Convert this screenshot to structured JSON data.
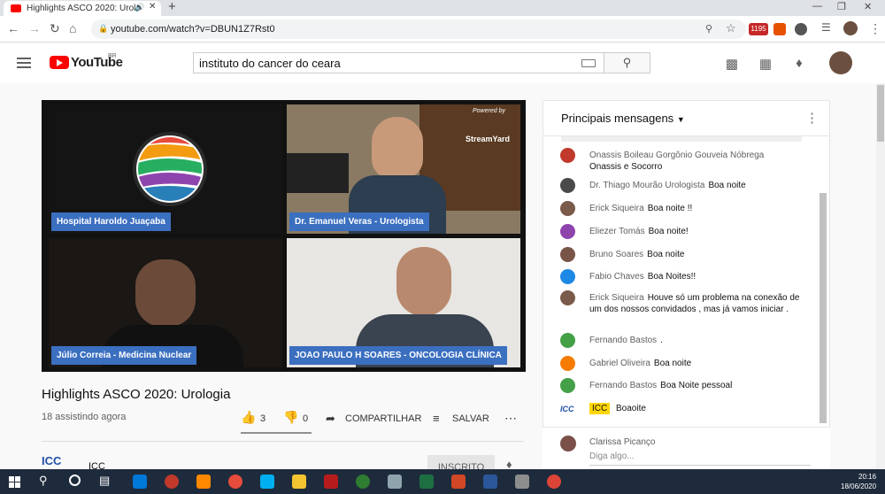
{
  "browser": {
    "tab_title": "Highlights ASCO 2020: Urolo",
    "url": "youtube.com/watch?v=DBUN1Z7Rst0",
    "ext_badge": "1195"
  },
  "youtube": {
    "logo_text": "YouTube",
    "region": "BR",
    "search_value": "instituto do cancer do ceara"
  },
  "video": {
    "watermark_top": "Powered by",
    "watermark_brand": "StreamYard",
    "participants": [
      "Hospital Haroldo Juaçaba",
      "Dr. Emanuel Veras - Urologista",
      "Júlio Correia - Medicina Nuclear",
      "JOAO PAULO H SOARES - ONCOLOGIA CLÍNICA"
    ],
    "title": "Highlights ASCO 2020: Urologia",
    "views": "18 assistindo agora",
    "likes": "3",
    "dislikes": "0",
    "share": "COMPARTILHAR",
    "save": "SALVAR",
    "channel_logo": "ICC",
    "channel_name": "ICC",
    "subscribe": "INSCRITO"
  },
  "chat": {
    "header": "Principais mensagens",
    "messages": [
      {
        "author": "Onassis Boileau Gorgônio Gouveia Nóbrega",
        "text": "Onassis e Socorro",
        "color": "#c0392b"
      },
      {
        "author": "Dr. Thiago Mourão Urologista",
        "text": "Boa noite",
        "color": "#4a4a4a"
      },
      {
        "author": "Erick Siqueira",
        "text": "Boa noite !!",
        "color": "#7a5a4a"
      },
      {
        "author": "Eliezer Tomás",
        "text": "Boa noite!",
        "color": "#8e44ad"
      },
      {
        "author": "Bruno Soares",
        "text": "Boa noite",
        "color": "#795548"
      },
      {
        "author": "Fabio Chaves",
        "text": "Boa Noites!!",
        "color": "#1e88e5"
      },
      {
        "author": "Erick Siqueira",
        "text": "Houve só um problema na conexão de um dos nossos convidados , mas já vamos iniciar .",
        "color": "#7a5a4a"
      },
      {
        "author": "Fernando Bastos",
        "text": ".",
        "color": "#43a047"
      },
      {
        "author": "Gabriel Oliveira",
        "text": "Boa noite",
        "color": "#f57c00"
      },
      {
        "author": "Fernando Bastos",
        "text": "Boa Noite pessoal",
        "color": "#43a047"
      },
      {
        "author": "ICC",
        "text": "Boaoite",
        "color": "#1f4fa8"
      }
    ],
    "input_user": "Clarissa Picanço",
    "input_placeholder": "Diga algo..."
  },
  "taskbar": {
    "time": "20:16",
    "date": "18/06/2020"
  }
}
